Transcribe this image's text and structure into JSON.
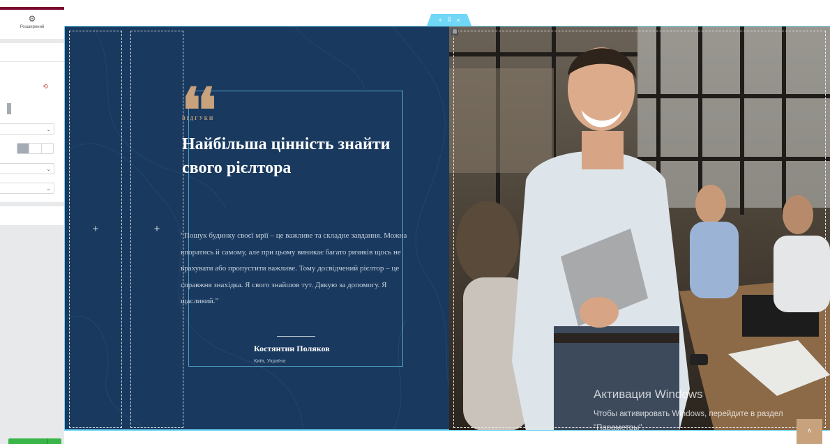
{
  "editor_panel": {
    "tab_label": "Розширений",
    "tab_icon": "gear-icon",
    "collapse_icon": "chevron-left-icon",
    "reset_icon": "reset-icon",
    "select_chevron": "⌄"
  },
  "section_handle": {
    "add_icon": "+",
    "drag_icon": "⠿",
    "close_icon": "×"
  },
  "columns": {
    "add_icon": "+"
  },
  "testimonial": {
    "quote_mark": "❛❛",
    "eyebrow": "ВІДГУКИ",
    "headline": "Найбільша цінність знайти свого рієлтора",
    "body": "“Пошук будинку своєї мрії – це важливе та складне завдання. Можна впоратись й самому, але при цьому виникає багато ризиків щось не врахувати або пропустити важливе. Тому досвідчений рієлтор – це справжня знахідка. Я свого знайшов тут. Дякую за допомогу. Я щасливий.”",
    "author": "Костянтин Поляков",
    "location": "Київ, Україна"
  },
  "photo": {
    "column_handle": "▥"
  },
  "windows_watermark": {
    "title": "Активация Windows",
    "subtitle": "Чтобы активировать Windows, перейдите в раздел \"Параметры\"."
  },
  "scroll_top": {
    "icon": "˄"
  },
  "colors": {
    "section_blue": "#19395f",
    "accent_gold": "#c7a27c",
    "editor_cyan": "#71d7f7",
    "publish_green": "#39b54a"
  }
}
